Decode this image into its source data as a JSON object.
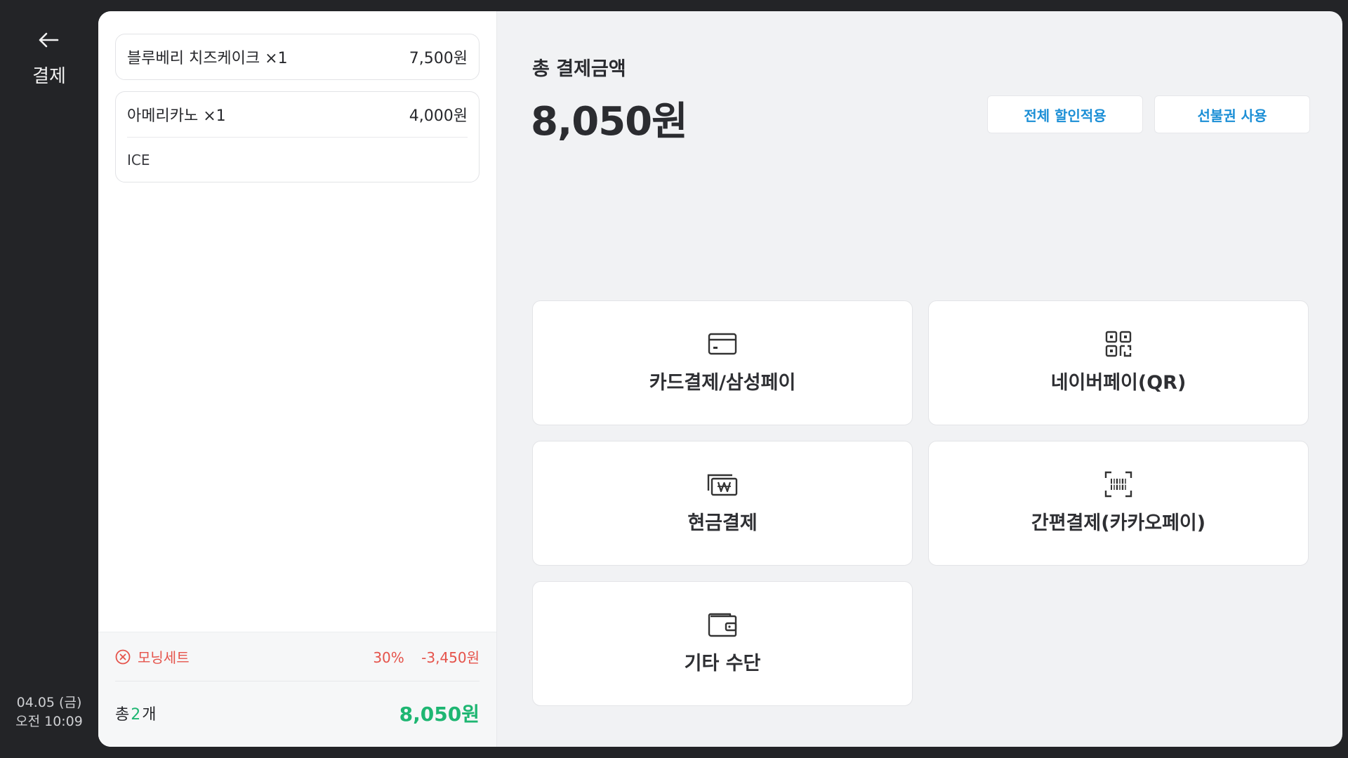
{
  "nav": {
    "title": "결제",
    "date": "04.05 (금)",
    "time": "오전 10:09"
  },
  "order": {
    "items": [
      {
        "name": "블루베리 치즈케이크 ×1",
        "price": "7,500원",
        "option": ""
      },
      {
        "name": "아메리카노 ×1",
        "price": "4,000원",
        "option": "ICE"
      }
    ],
    "discount": {
      "label": "모닝세트",
      "rate": "30%",
      "amount": "-3,450원"
    },
    "total": {
      "prefix": "총",
      "count": "2",
      "suffix": "개",
      "amount": "8,050원"
    }
  },
  "payment": {
    "label": "총 결제금액",
    "total": "8,050원",
    "actions": {
      "discount_all": "전체 할인적용",
      "voucher": "선불권 사용"
    },
    "methods": [
      {
        "label": "카드결제/삼성페이",
        "icon": "credit-card-icon"
      },
      {
        "label": "네이버페이(QR)",
        "icon": "qr-code-icon"
      },
      {
        "label": "현금결제",
        "icon": "cash-icon"
      },
      {
        "label": "간편결제(카카오페이)",
        "icon": "barcode-scan-icon"
      },
      {
        "label": "기타 수단",
        "icon": "wallet-icon"
      }
    ]
  },
  "colors": {
    "accent_blue": "#1c8fd6",
    "accent_green": "#1eb672",
    "discount_red": "#e5534b"
  }
}
